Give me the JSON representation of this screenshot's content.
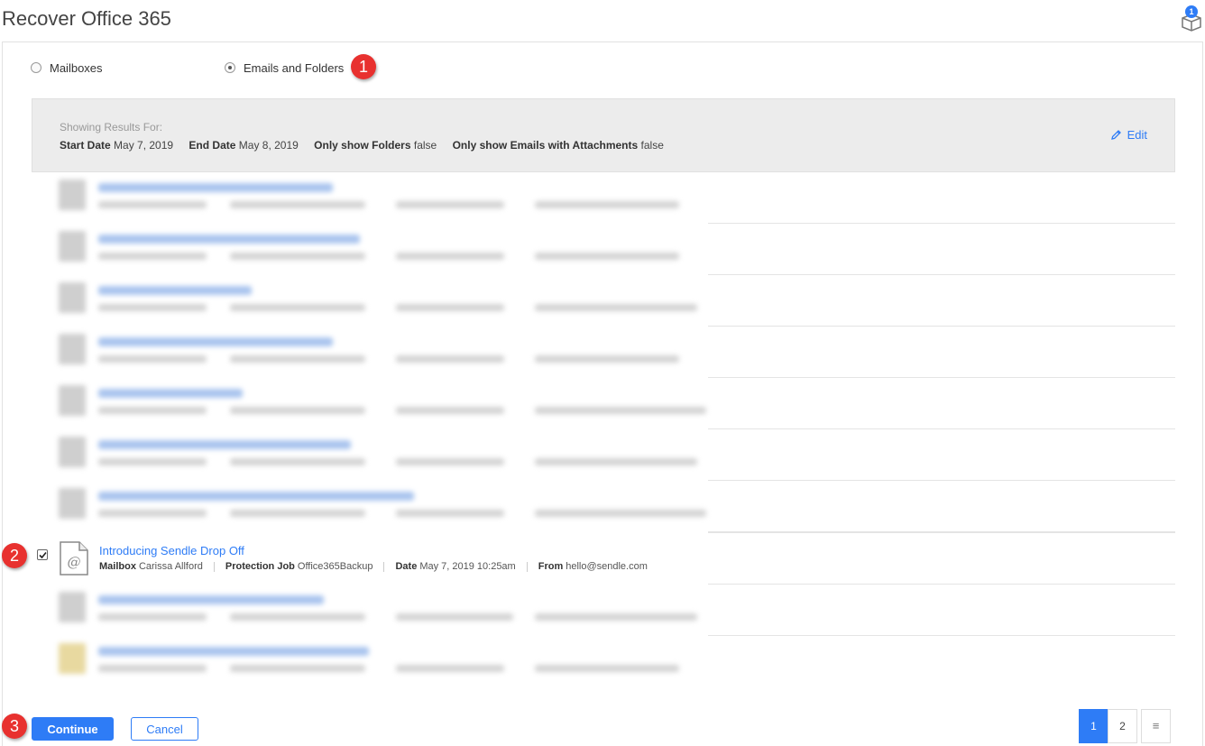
{
  "header": {
    "title": "Recover Office 365",
    "cart_badge": "1"
  },
  "recovery_type": {
    "options": [
      {
        "label": "Mailboxes",
        "selected": false
      },
      {
        "label": "Emails and Folders",
        "selected": true
      }
    ]
  },
  "filters": {
    "heading": "Showing Results For:",
    "criteria": [
      {
        "label": "Start Date",
        "value": "May 7, 2019"
      },
      {
        "label": "End Date",
        "value": "May 8, 2019"
      },
      {
        "label": "Only show Folders",
        "value": "false"
      },
      {
        "label": "Only show Emails with Attachments",
        "value": "false"
      }
    ],
    "edit_label": "Edit"
  },
  "selected_email": {
    "checked": true,
    "subject": "Introducing Sendle Drop Off",
    "meta": [
      {
        "label": "Mailbox",
        "value": "Carissa Allford"
      },
      {
        "label": "Protection Job",
        "value": "Office365Backup"
      },
      {
        "label": "Date",
        "value": "May 7, 2019 10:25am"
      },
      {
        "label": "From",
        "value": "hello@sendle.com"
      }
    ]
  },
  "markers": [
    "1",
    "2",
    "3"
  ],
  "actions": {
    "continue_label": "Continue",
    "cancel_label": "Cancel"
  },
  "pagination": {
    "pages": [
      "1",
      "2"
    ],
    "current": "1",
    "list_icon": "≡"
  },
  "colors": {
    "accent": "#2e7cf6",
    "marker": "#e8312f"
  }
}
